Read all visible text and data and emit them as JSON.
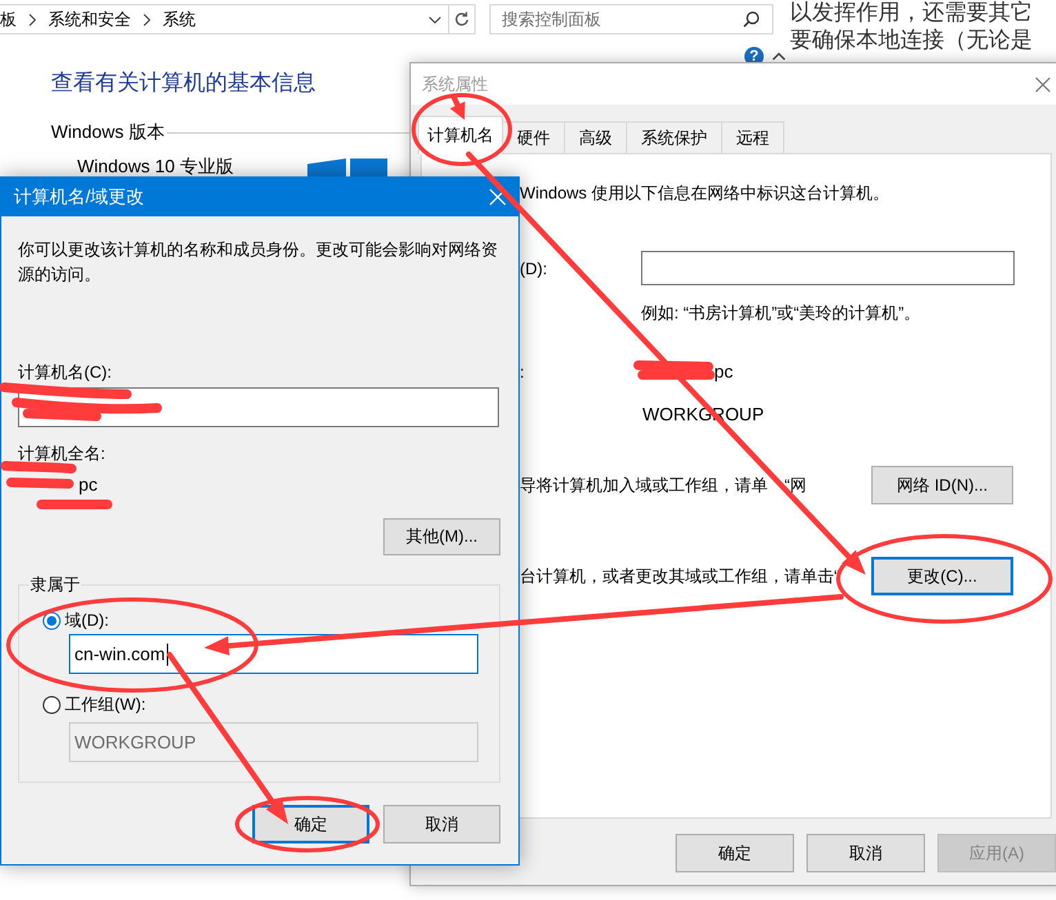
{
  "address_bar": {
    "breadcrumb": [
      "板",
      "系统和安全",
      "系统"
    ]
  },
  "search": {
    "placeholder": "搜索控制面板"
  },
  "help_button": "?",
  "control_panel": {
    "heading": "查看有关计算机的基本信息",
    "section": "Windows 版本",
    "edition": "Windows 10 专业版"
  },
  "web_page": {
    "lines": [
      "以发挥作用，还需要其它",
      "要确保本地连接（无论是"
    ]
  },
  "system_properties": {
    "title": "系统属性",
    "tabs": [
      {
        "label": "计算机名",
        "selected": true
      },
      {
        "label": "硬件",
        "selected": false
      },
      {
        "label": "高级",
        "selected": false
      },
      {
        "label": "系统保护",
        "selected": false
      },
      {
        "label": "远程",
        "selected": false
      }
    ],
    "intro": "Windows 使用以下信息在网络中标识这台计算机。",
    "description_label": "(D):",
    "description_hint": "例如: “书房计算机”或“美玲的计算机”。",
    "full_name_label": ":",
    "full_name": "pc",
    "workgroup": "WORKGROUP",
    "network_id_text": [
      "导将计算机加入域或工作组，请单",
      "“网"
    ],
    "network_id_button": "网络 ID(N)...",
    "rename_text": "台计算机，或者更改其域或工作组，请单击“",
    "change_button": {
      "label": "更改(C)...",
      "focused": true
    },
    "buttons": [
      {
        "label": "确定",
        "disabled": false
      },
      {
        "label": "取消",
        "disabled": false
      },
      {
        "label": "应用(A)",
        "disabled": true
      }
    ]
  },
  "name_dialog": {
    "title": "计算机名/域更改",
    "description": "你可以更改该计算机的名称和成员身份。更改可能会影响对网络资源的访问。",
    "computer_name_label": "计算机名(C):",
    "full_name_label": "计算机全名:",
    "full_name": "pc",
    "more_button": "其他(M)...",
    "member_of": {
      "legend": "隶属于",
      "options": [
        {
          "label": "域(D):",
          "selected": true,
          "value": "cn-win.com",
          "focused": true
        },
        {
          "label": "工作组(W):",
          "selected": false,
          "value": "WORKGROUP",
          "focused": false
        }
      ]
    },
    "buttons": [
      {
        "label": "确定",
        "focused": true
      },
      {
        "label": "取消",
        "focused": false
      }
    ]
  }
}
